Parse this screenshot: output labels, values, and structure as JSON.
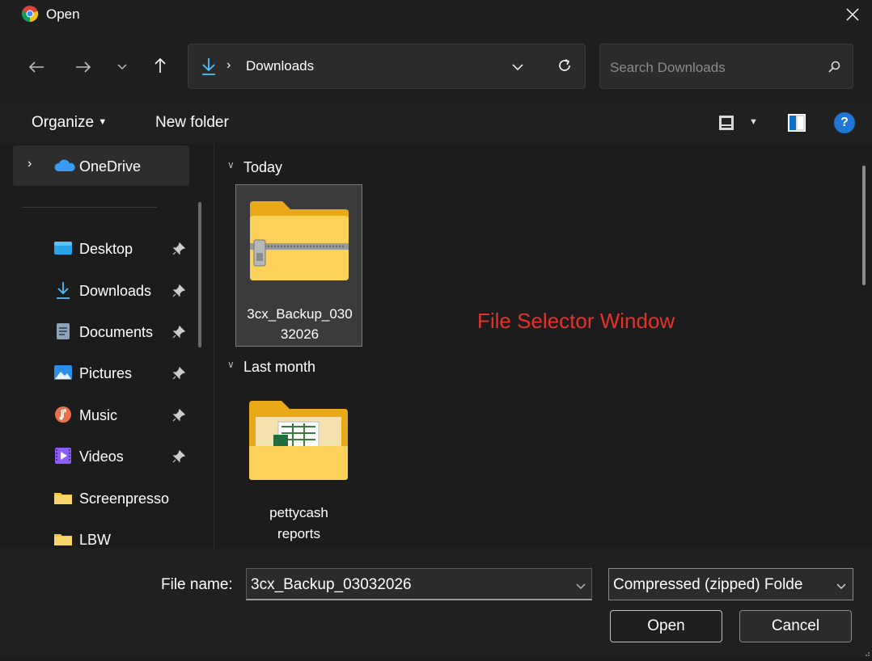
{
  "window": {
    "title": "Open"
  },
  "nav": {
    "breadcrumb": "Downloads",
    "search_placeholder": "Search Downloads"
  },
  "toolbar": {
    "organize_label": "Organize",
    "new_folder_label": "New folder"
  },
  "sidebar": {
    "onedrive": "OneDrive",
    "items": [
      {
        "label": "Desktop",
        "icon": "desktop-icon",
        "pinned": true
      },
      {
        "label": "Downloads",
        "icon": "downloads-icon",
        "pinned": true
      },
      {
        "label": "Documents",
        "icon": "documents-icon",
        "pinned": true
      },
      {
        "label": "Pictures",
        "icon": "pictures-icon",
        "pinned": true
      },
      {
        "label": "Music",
        "icon": "music-icon",
        "pinned": true
      },
      {
        "label": "Videos",
        "icon": "videos-icon",
        "pinned": true
      },
      {
        "label": "Screenpresso",
        "icon": "folder-icon",
        "pinned": false
      },
      {
        "label": "LBW",
        "icon": "folder-icon",
        "pinned": false
      }
    ]
  },
  "content": {
    "groups": [
      {
        "header": "Today",
        "files": [
          {
            "name_line1": "3cx_Backup_030",
            "name_line2": "32026",
            "icon": "zip-folder-icon",
            "selected": true
          }
        ]
      },
      {
        "header": "Last month",
        "files": [
          {
            "name_line1": "pettycash",
            "name_line2": "reports",
            "icon": "folder-icon",
            "selected": false
          }
        ]
      }
    ],
    "annotation": "File Selector Window"
  },
  "bottom": {
    "file_name_label": "File name:",
    "file_name_value": "3cx_Backup_03032026",
    "file_type_value": "Compressed (zipped) Folde",
    "open_label": "Open",
    "cancel_label": "Cancel"
  },
  "colors": {
    "annotation": "#e8312a",
    "accent": "#0078d4",
    "folder": "#f5c242"
  }
}
